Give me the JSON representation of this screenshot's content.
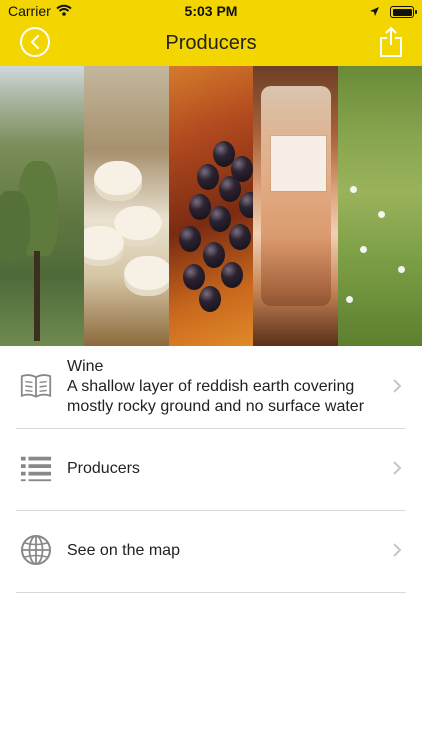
{
  "status": {
    "carrier": "Carrier",
    "time": "5:03 PM"
  },
  "nav": {
    "title": "Producers"
  },
  "list": {
    "items": [
      {
        "title": "Wine",
        "subtitle": "A shallow layer of reddish earth covering mostly rocky ground and no surface water",
        "icon": "open-book-icon"
      },
      {
        "title": "Producers",
        "icon": "list-icon"
      },
      {
        "title": "See on the map",
        "icon": "globe-icon"
      }
    ]
  },
  "colors": {
    "accent": "#f3d500",
    "icon": "#888888",
    "divider": "#d9d9d9"
  }
}
